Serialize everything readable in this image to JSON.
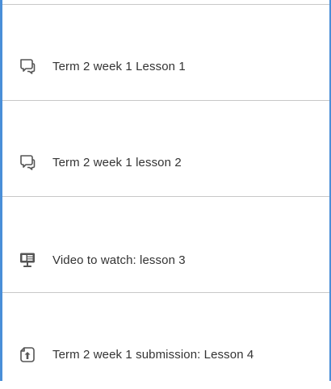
{
  "items": [
    {
      "label": "Term 2 week 1 Lesson 1",
      "icon": "forum-icon"
    },
    {
      "label": "Term 2 week 1 lesson 2",
      "icon": "forum-icon"
    },
    {
      "label": "Video to watch: lesson 3",
      "icon": "presentation-icon"
    },
    {
      "label": "Term 2 week 1 submission: Lesson 4",
      "icon": "assignment-upload-icon"
    }
  ],
  "colors": {
    "frame_border": "#4a8fd8",
    "divider": "#c8c8c8",
    "text": "#333333",
    "icon": "#555555"
  }
}
